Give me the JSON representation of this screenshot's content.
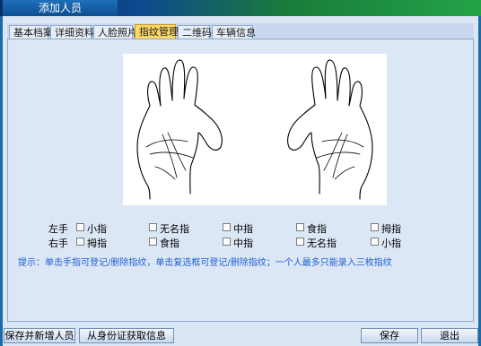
{
  "window": {
    "title": "添加人员"
  },
  "tabs": [
    {
      "label": "基本档案"
    },
    {
      "label": "详细资料"
    },
    {
      "label": "人脸照片"
    },
    {
      "label": "指纹管理"
    },
    {
      "label": "二维码"
    },
    {
      "label": "车辆信息"
    }
  ],
  "active_tab": "指纹管理",
  "left_hand": {
    "label": "左手",
    "fingers": [
      "小指",
      "无名指",
      "中指",
      "食指",
      "拇指"
    ]
  },
  "right_hand": {
    "label": "右手",
    "fingers": [
      "拇指",
      "食指",
      "中指",
      "无名指",
      "小指"
    ]
  },
  "hint": "提示：单击手指可登记/删除指纹，单击复选框可登记/删除指纹；一个人最多只能录入三枚指纹",
  "buttons": {
    "save_and_add": "保存并新增人员",
    "read_id_card": "从身份证获取信息",
    "save": "保存",
    "exit": "退出"
  },
  "colors": {
    "accent": "#1d6aa8",
    "hint": "#1f5fd6",
    "active_tab": "#ffd868"
  }
}
